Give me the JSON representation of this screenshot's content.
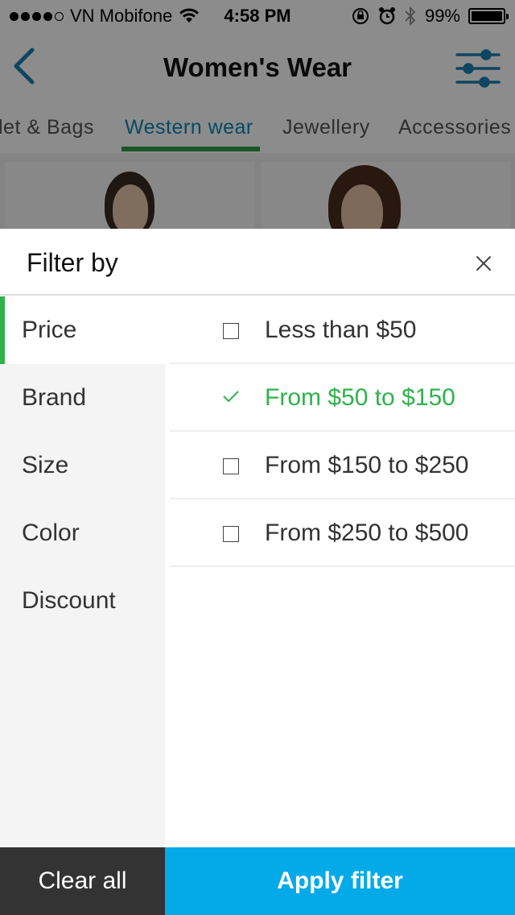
{
  "status_bar": {
    "carrier": "VN Mobifone",
    "time": "4:58 PM",
    "battery": "99%",
    "battery_level": 0.99
  },
  "navbar": {
    "title": "Women's Wear",
    "back_icon": "chevron-left-icon",
    "filter_icon": "sliders-icon",
    "accent_color": "#1a7fb0"
  },
  "tabs": [
    {
      "label": "let & Bags",
      "active": false
    },
    {
      "label": "Western wear",
      "active": true
    },
    {
      "label": "Jewellery",
      "active": false
    },
    {
      "label": "Accessories",
      "active": false
    }
  ],
  "filter": {
    "title": "Filter by",
    "close_icon": "close-icon",
    "categories": [
      {
        "label": "Price",
        "active": true
      },
      {
        "label": "Brand",
        "active": false
      },
      {
        "label": "Size",
        "active": false
      },
      {
        "label": "Color",
        "active": false
      },
      {
        "label": "Discount",
        "active": false
      }
    ],
    "options": [
      {
        "label": "Less than $50",
        "selected": false
      },
      {
        "label": "From $50 to $150",
        "selected": true
      },
      {
        "label": "From $150 to $250",
        "selected": false
      },
      {
        "label": "From $250 to $500",
        "selected": false
      }
    ],
    "clear_label": "Clear all",
    "apply_label": "Apply filter",
    "selected_color": "#2fb24b",
    "apply_color": "#04aae8"
  }
}
